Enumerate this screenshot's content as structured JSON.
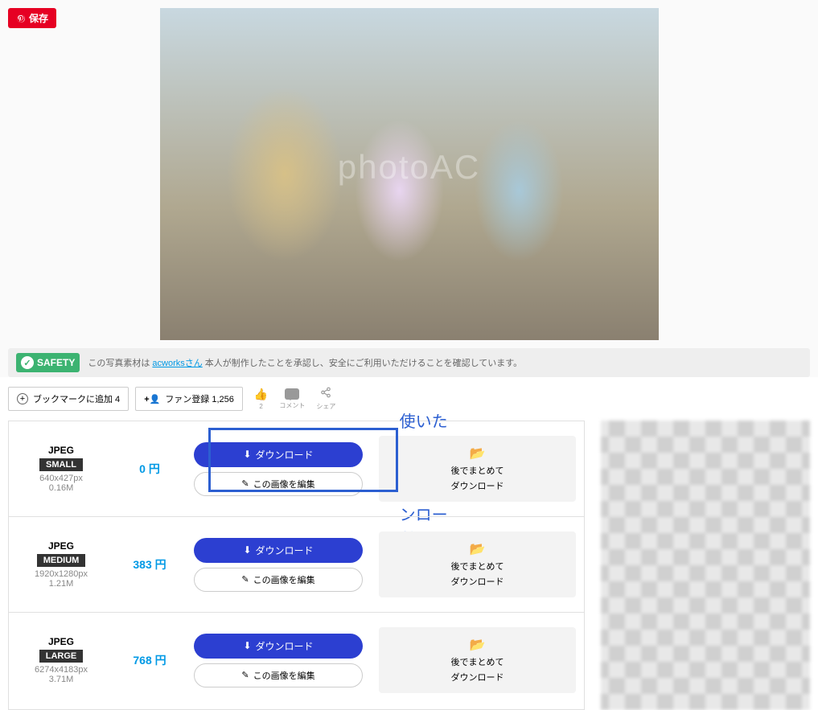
{
  "pinterest": {
    "save": "保存"
  },
  "watermark": "photoAC",
  "safety": {
    "badge": "SAFETY",
    "text_before": "この写真素材は ",
    "author_link": "acworksさん",
    "text_after": " 本人が制作したことを承認し、安全にご利用いただけることを確認しています。"
  },
  "actions": {
    "bookmark": "ブックマークに追加 4",
    "fan": "ファン登録 1,256",
    "like_count": "2",
    "comment": "コメント",
    "share": "シェア"
  },
  "callout": "使いたい画像を無料でダウンロード",
  "bulk": {
    "line1": "後でまとめて",
    "line2": "ダウンロード"
  },
  "common": {
    "download_btn": "ダウンロード",
    "edit_btn": "この画像を編集"
  },
  "rows": [
    {
      "format": "JPEG",
      "size_tag": "SMALL",
      "dimensions": "640x427px",
      "filesize": "0.16M",
      "price": "0 円"
    },
    {
      "format": "JPEG",
      "size_tag": "MEDIUM",
      "dimensions": "1920x1280px",
      "filesize": "1.21M",
      "price": "383 円"
    },
    {
      "format": "JPEG",
      "size_tag": "LARGE",
      "dimensions": "6274x4183px",
      "filesize": "3.71M",
      "price": "768 円"
    }
  ]
}
